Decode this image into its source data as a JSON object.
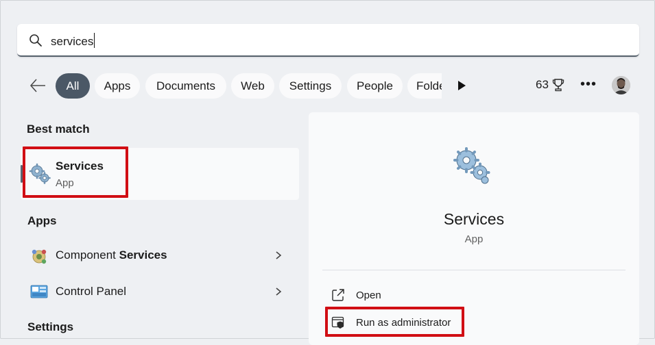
{
  "search": {
    "value": "services",
    "icon": "search-icon"
  },
  "filters": {
    "back_icon": "arrow-left-icon",
    "chips": [
      {
        "label": "All",
        "active": true
      },
      {
        "label": "Apps"
      },
      {
        "label": "Documents"
      },
      {
        "label": "Web"
      },
      {
        "label": "Settings"
      },
      {
        "label": "People"
      },
      {
        "label": "Folde"
      }
    ],
    "more_icon": "play-right-icon",
    "points": "63",
    "points_icon": "trophy-icon",
    "menu_label": "•••",
    "avatar_icon": "avatar"
  },
  "left": {
    "best_match_heading": "Best match",
    "best_match": {
      "title": "Services",
      "subtitle": "App",
      "icon": "services-gears-icon"
    },
    "apps_heading": "Apps",
    "apps": [
      {
        "label_prefix": "Component ",
        "label_bold": "Services",
        "icon": "component-services-icon"
      },
      {
        "label_prefix": "Control Panel",
        "label_bold": "",
        "icon": "control-panel-icon"
      }
    ],
    "settings_heading": "Settings"
  },
  "preview": {
    "title": "Services",
    "subtitle": "App",
    "icon": "services-gears-icon",
    "actions": [
      {
        "label": "Open",
        "icon": "open-external-icon"
      },
      {
        "label": "Run as administrator",
        "icon": "admin-shield-icon"
      }
    ]
  },
  "colors": {
    "highlight": "#d10e14",
    "active_chip": "#4b5866",
    "background": "#eef0f3",
    "card": "#f9fafb"
  }
}
